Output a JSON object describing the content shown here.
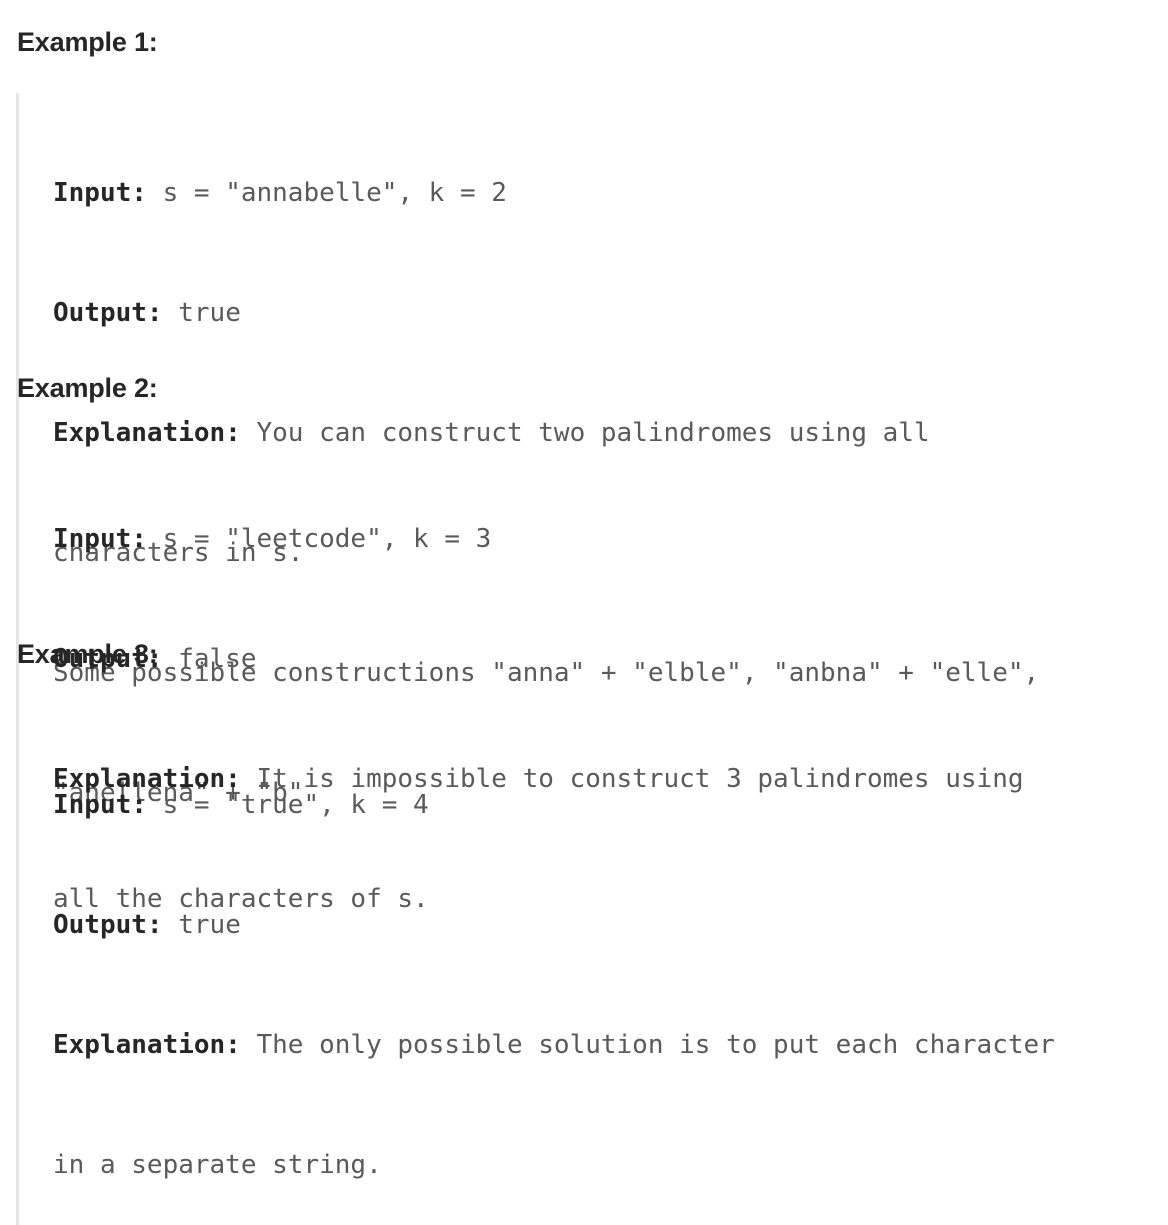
{
  "examples": [
    {
      "title": "Example 1:",
      "input_label": "Input:",
      "input_value": " s = \"annabelle\", k = 2",
      "output_label": "Output:",
      "output_value": " true",
      "explanation_label": "Explanation:",
      "explanation_lines": [
        " You can construct two palindromes using all",
        "characters in s.",
        "Some possible constructions \"anna\" + \"elble\", \"anbna\" + \"elle\",",
        "\"anellena\" + \"b\""
      ]
    },
    {
      "title": "Example 2:",
      "input_label": "Input:",
      "input_value": " s = \"leetcode\", k = 3",
      "output_label": "Output:",
      "output_value": " false",
      "explanation_label": "Explanation:",
      "explanation_lines": [
        " It is impossible to construct 3 palindromes using",
        "all the characters of s."
      ]
    },
    {
      "title": "Example 3:",
      "input_label": "Input:",
      "input_value": " s = \"true\", k = 4",
      "output_label": "Output:",
      "output_value": " true",
      "explanation_label": "Explanation:",
      "explanation_lines": [
        " The only possible solution is to put each character",
        "in a separate string."
      ]
    }
  ]
}
